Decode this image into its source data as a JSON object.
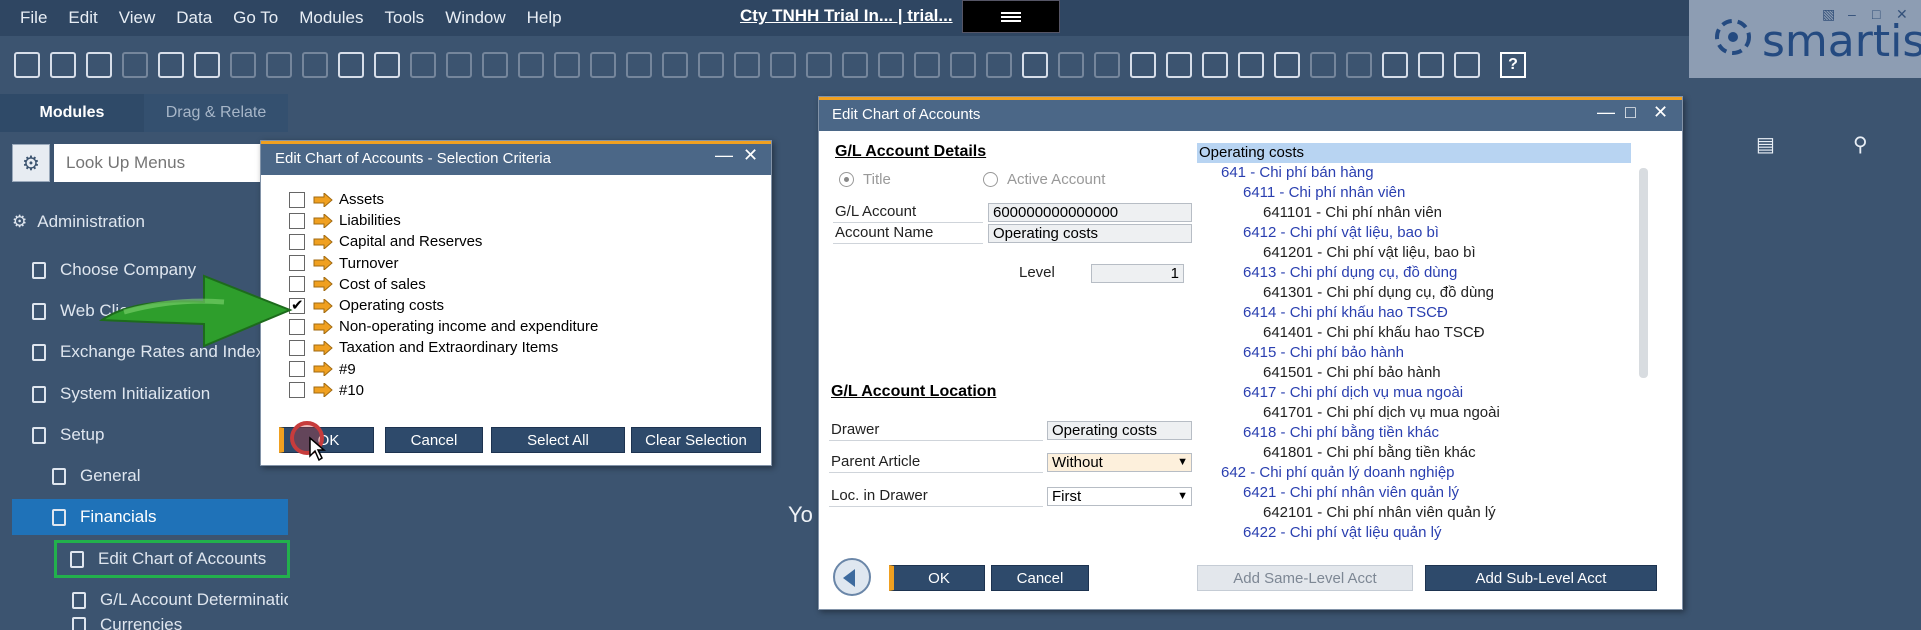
{
  "menubar": {
    "items": [
      "File",
      "Edit",
      "View",
      "Data",
      "Go To",
      "Modules",
      "Tools",
      "Window",
      "Help"
    ],
    "db_title": "Cty TNHH Trial In... | trial..."
  },
  "brand": {
    "logo_text": "smartis",
    "accent": "#f0a020",
    "selected": "#1f72b8",
    "highlight": "#22b14c"
  },
  "sidebar": {
    "tabs": [
      "Modules",
      "Drag & Relate"
    ],
    "search_placeholder": "Look Up Menus",
    "items": [
      {
        "label": "Administration"
      },
      {
        "label": "Choose Company"
      },
      {
        "label": "Web Client"
      },
      {
        "label": "Exchange Rates and Indexes"
      },
      {
        "label": "System Initialization"
      },
      {
        "label": "Setup"
      },
      {
        "label": "General"
      },
      {
        "label": "Financials"
      },
      {
        "label": "Edit Chart of Accounts"
      },
      {
        "label": "G/L Account Determination"
      },
      {
        "label": "Currencies"
      }
    ]
  },
  "selection_dialog": {
    "title": "Edit Chart of Accounts - Selection Criteria",
    "criteria": [
      {
        "label": "Assets",
        "checked": false
      },
      {
        "label": "Liabilities",
        "checked": false
      },
      {
        "label": "Capital and Reserves",
        "checked": false
      },
      {
        "label": "Turnover",
        "checked": false
      },
      {
        "label": "Cost of sales",
        "checked": false
      },
      {
        "label": "Operating costs",
        "checked": true
      },
      {
        "label": "Non-operating income and expenditure",
        "checked": false
      },
      {
        "label": "Taxation and Extraordinary Items",
        "checked": false
      },
      {
        "label": "#9",
        "checked": false
      },
      {
        "label": "#10",
        "checked": false
      }
    ],
    "buttons": {
      "ok": "OK",
      "cancel": "Cancel",
      "select_all": "Select All",
      "clear": "Clear Selection"
    }
  },
  "coa_dialog": {
    "title": "Edit Chart of Accounts",
    "details_title": "G/L Account Details",
    "radio_title": "Title",
    "radio_active": "Active Account",
    "gl_account_label": "G/L Account",
    "gl_account_value": "600000000000000",
    "account_name_label": "Account Name",
    "account_name_value": "Operating costs",
    "level_label": "Level",
    "level_value": "1",
    "location_title": "G/L Account Location",
    "drawer_label": "Drawer",
    "drawer_value": "Operating costs",
    "parent_label": "Parent Article",
    "parent_value": "Without",
    "loc_label": "Loc. in Drawer",
    "loc_value": "First",
    "buttons": {
      "ok": "OK",
      "cancel": "Cancel",
      "add_same": "Add Same-Level Acct",
      "add_sub": "Add Sub-Level Acct"
    },
    "tree": [
      {
        "text": "Operating costs",
        "style": "sel"
      },
      {
        "text": "641 - Chi phí bán hàng",
        "style": "blue"
      },
      {
        "text": "6411 - Chi phí nhân viên",
        "style": "blue"
      },
      {
        "text": "641101 - Chi phí nhân viên",
        "style": "dark"
      },
      {
        "text": "6412 - Chi phí vật liệu, bao bì",
        "style": "blue"
      },
      {
        "text": "641201 - Chi phí vật liệu, bao bì",
        "style": "dark"
      },
      {
        "text": "6413 - Chi phí dụng cụ, đồ dùng",
        "style": "blue"
      },
      {
        "text": "641301 - Chi phí dụng cụ, đồ dùng",
        "style": "dark"
      },
      {
        "text": "6414 - Chi phí khấu hao TSCĐ",
        "style": "blue"
      },
      {
        "text": "641401 - Chi phí khấu hao TSCĐ",
        "style": "dark"
      },
      {
        "text": "6415 - Chi phí bảo hành",
        "style": "blue"
      },
      {
        "text": "641501 - Chi phí bảo hành",
        "style": "dark"
      },
      {
        "text": "6417 - Chi phí dịch vụ mua ngoài",
        "style": "blue"
      },
      {
        "text": "641701 - Chi phí dịch vụ mua ngoài",
        "style": "dark"
      },
      {
        "text": "6418 - Chi phí bằng tiền khác",
        "style": "blue"
      },
      {
        "text": "641801 - Chi phí bằng tiền khác",
        "style": "dark"
      },
      {
        "text": "642 - Chi phí quản lý doanh nghiệp",
        "style": "blue"
      },
      {
        "text": "6421 - Chi phí nhân viên quản lý",
        "style": "blue"
      },
      {
        "text": "642101 - Chi phí nhân viên quản lý",
        "style": "dark"
      },
      {
        "text": "6422 - Chi phí vật liệu quản lý",
        "style": "blue"
      }
    ]
  },
  "background_text": "Yo"
}
